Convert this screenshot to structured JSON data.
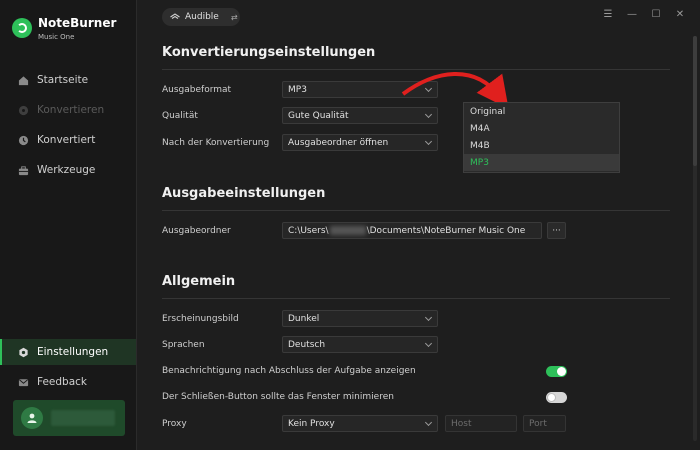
{
  "app": {
    "name": "NoteBurner",
    "subtitle": "Music One"
  },
  "sidebar": {
    "items": [
      {
        "label": "Startseite",
        "icon": "home-icon",
        "state": "normal"
      },
      {
        "label": "Konvertieren",
        "icon": "convert-icon",
        "state": "disabled"
      },
      {
        "label": "Konvertiert",
        "icon": "clock-icon",
        "state": "normal"
      },
      {
        "label": "Werkzeuge",
        "icon": "toolbox-icon",
        "state": "normal"
      },
      {
        "label": "Einstellungen",
        "icon": "gear-icon",
        "state": "active"
      },
      {
        "label": "Feedback",
        "icon": "mail-icon",
        "state": "normal"
      }
    ]
  },
  "topbar": {
    "source_label": "Audible",
    "source_icon": "audible-icon"
  },
  "sections": {
    "conversion": {
      "title": "Konvertierungseinstellungen",
      "format_label": "Ausgabeformat",
      "format_value": "MP3",
      "quality_label": "Qualität",
      "quality_value": "Gute Qualität",
      "after_label": "Nach der Konvertierung",
      "after_value": "Ausgabeordner öffnen"
    },
    "output": {
      "title": "Ausgabeeinstellungen",
      "folder_label": "Ausgabeordner",
      "folder_prefix": "C:\\Users\\",
      "folder_suffix": "\\Documents\\NoteBurner Music One",
      "browse_label": "···"
    },
    "general": {
      "title": "Allgemein",
      "appearance_label": "Erscheinungsbild",
      "appearance_value": "Dunkel",
      "language_label": "Sprachen",
      "language_value": "Deutsch",
      "notify_label": "Benachrichtigung nach Abschluss der Aufgabe anzeigen",
      "notify_on": true,
      "minimize_label": "Der Schließen-Button sollte das Fenster minimieren",
      "minimize_on": false,
      "proxy_label": "Proxy",
      "proxy_value": "Kein Proxy",
      "host_placeholder": "Host",
      "port_placeholder": "Port"
    }
  },
  "format_dropdown": {
    "options": [
      "Original",
      "M4A",
      "M4B",
      "MP3"
    ],
    "selected": "MP3"
  },
  "colors": {
    "accent": "#2ec05a",
    "background": "#1e1e1e",
    "sidebar": "#181818",
    "arrow": "#e0201e"
  }
}
